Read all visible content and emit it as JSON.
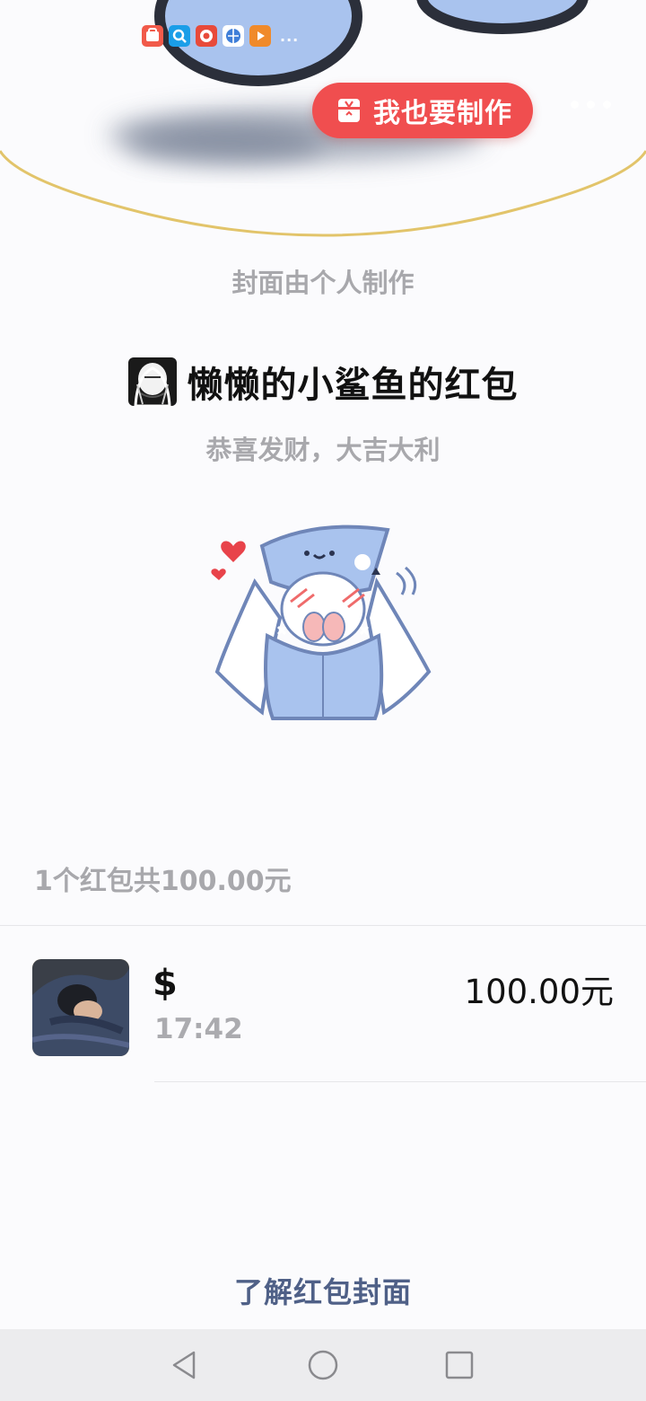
{
  "header": {
    "make_button_label": "我也要制作",
    "status_more": "...",
    "status_apps": [
      "shopping-app-icon",
      "search-app-icon",
      "browser-app-icon",
      "network-app-icon",
      "video-app-icon"
    ]
  },
  "cover": {
    "credit": "封面由个人制作"
  },
  "envelope": {
    "sender_title": "懒懒的小鲨鱼的红包",
    "greeting": "恭喜发财，大吉大利"
  },
  "summary": {
    "text": "1个红包共100.00元"
  },
  "records": [
    {
      "name": "$",
      "time": "17:42",
      "amount": "100.00元"
    }
  ],
  "footer": {
    "learn_link": "了解红包封面"
  },
  "navbar": {
    "buttons": [
      "back-icon",
      "home-icon",
      "recent-apps-icon"
    ]
  },
  "colors": {
    "accent_red": "#f04e4f",
    "link_blue": "#4f6087",
    "cover_blue": "#a9c3ee",
    "cover_line_gold": "#e2c46a"
  }
}
